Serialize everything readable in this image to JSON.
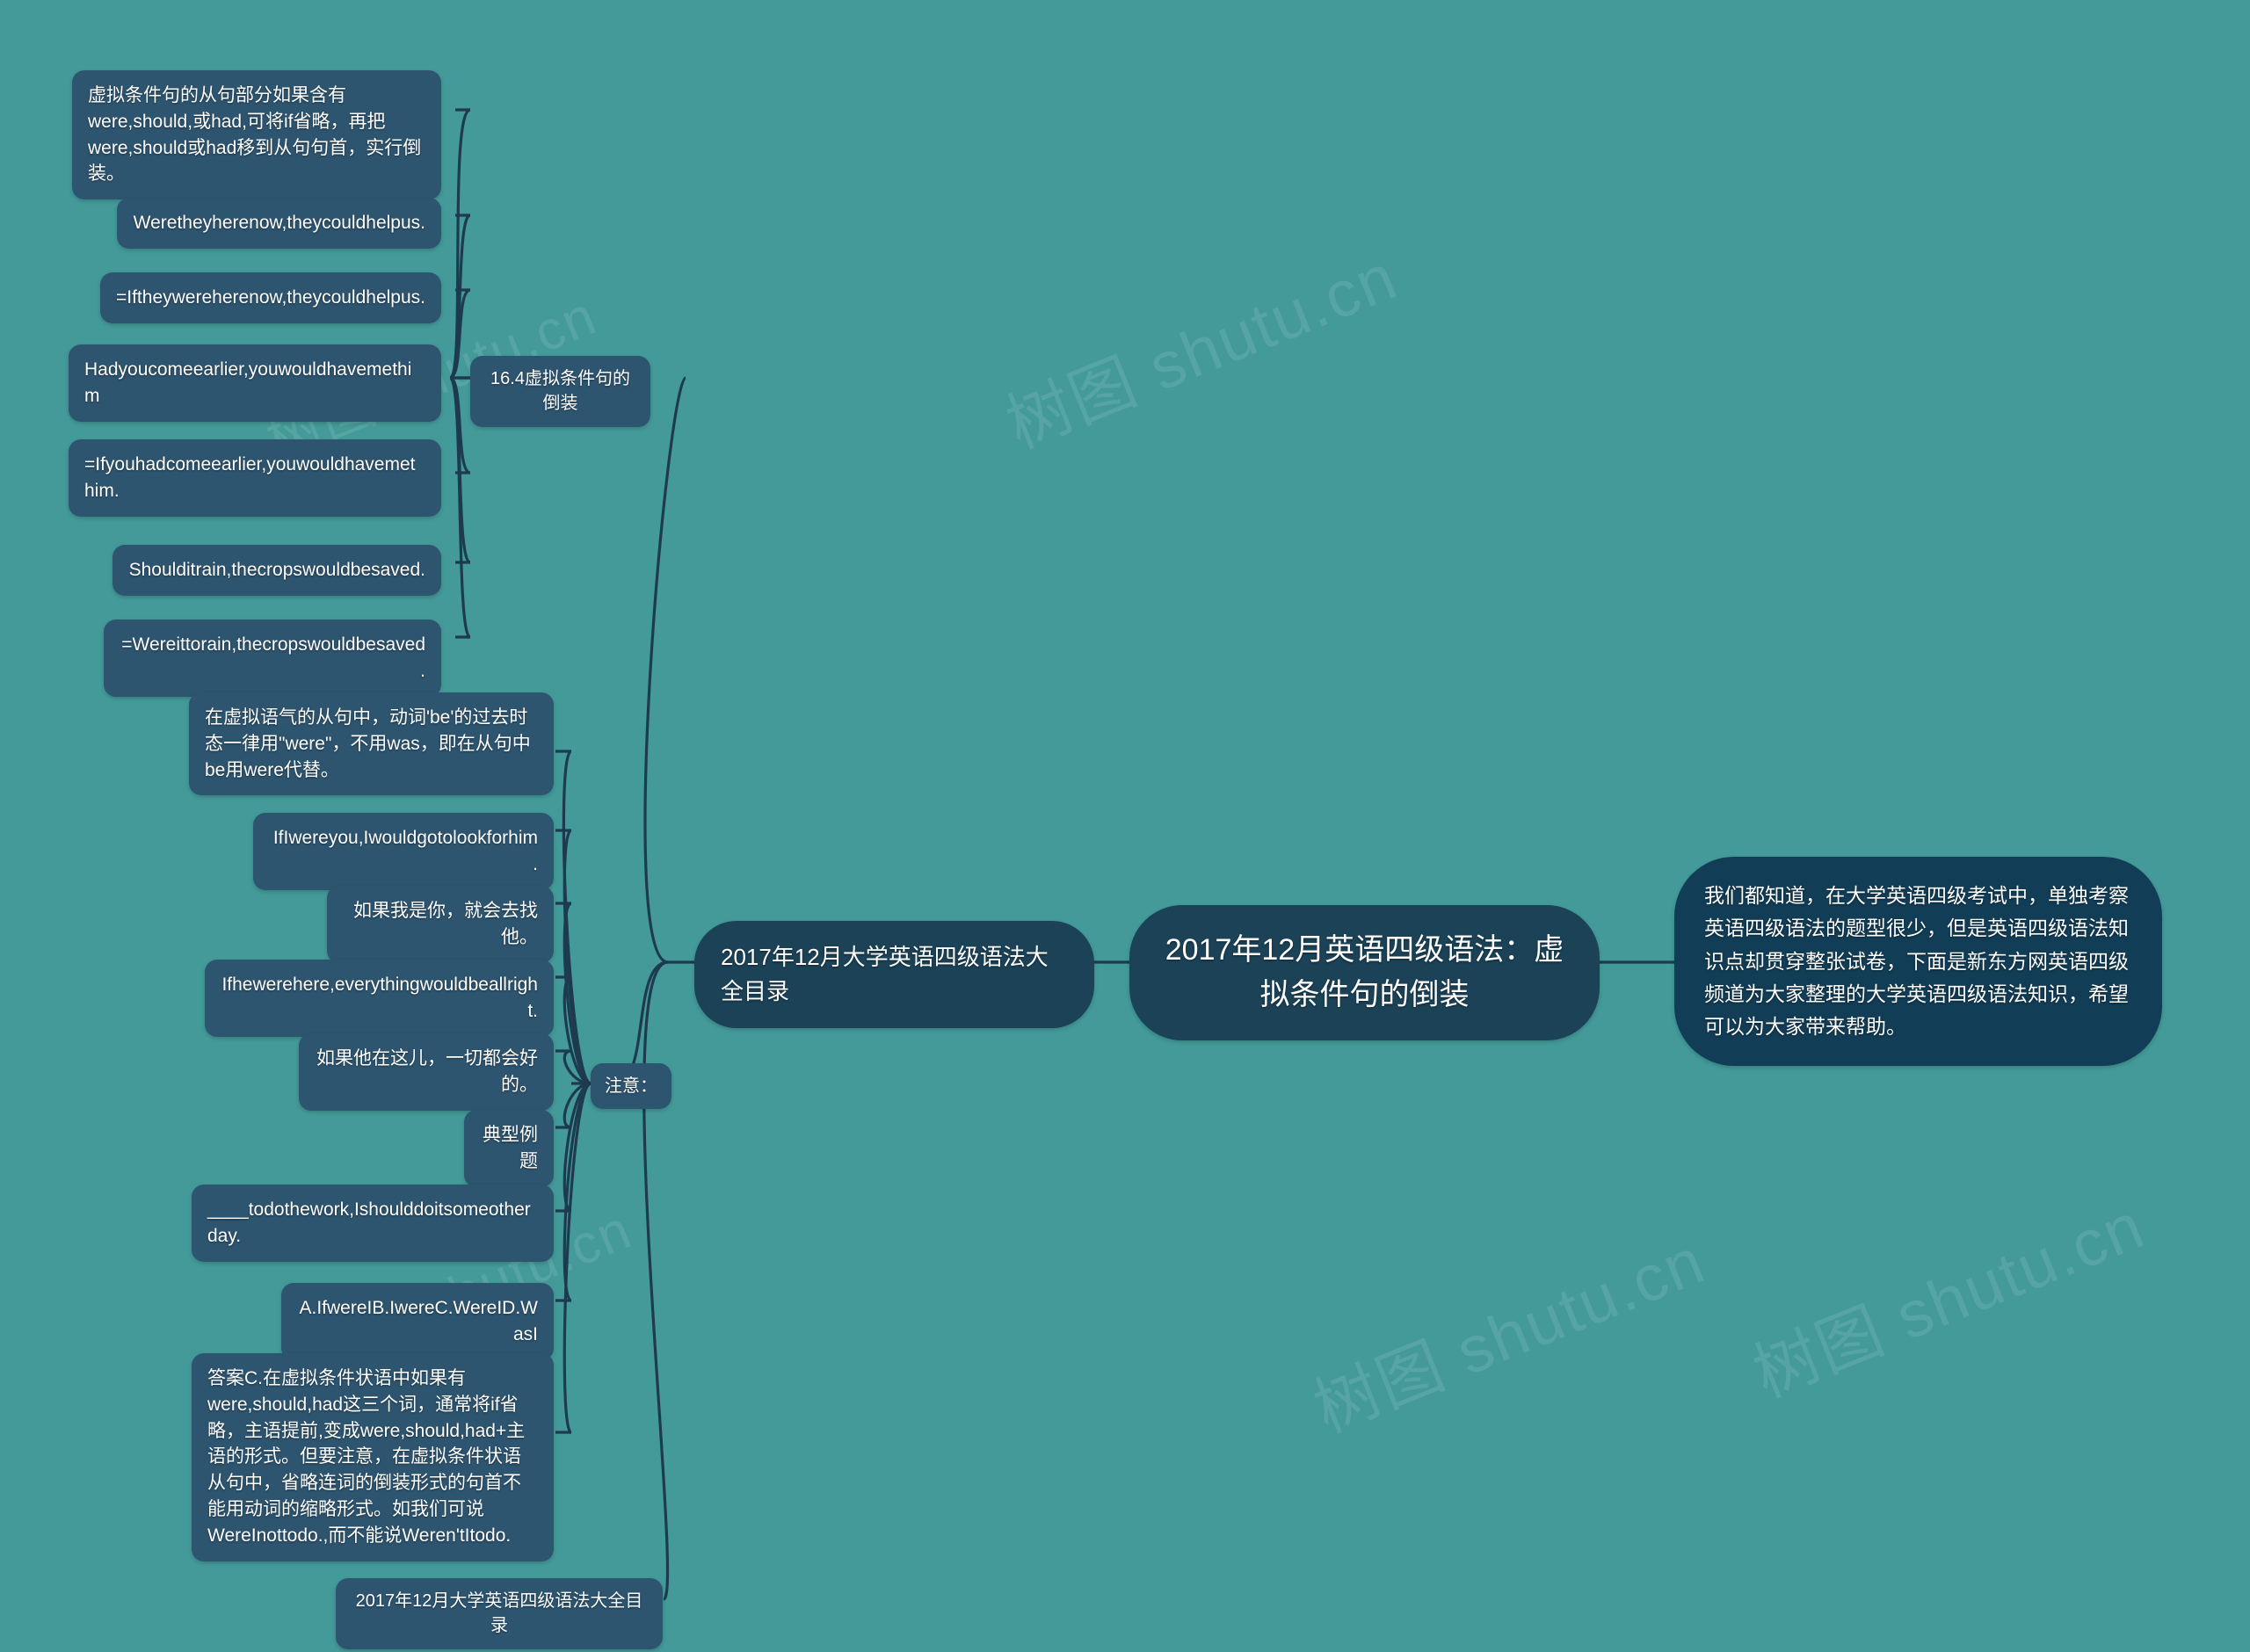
{
  "theme": {
    "background": "#439a99",
    "node_fill": "#2e5570",
    "trunk_fill": "#1b4257",
    "desc_fill": "#123d56",
    "edge_color": "#1d3a4f",
    "text_color": "#ffffff"
  },
  "watermarks": [
    "树图 shutu.cn",
    "树图 shutu.cn",
    "树图 shutu.cn",
    "树图 shutu.cn",
    "树图 shutu.cn"
  ],
  "mindmap": {
    "root": {
      "title": "2017年12月英语四级语法：虚拟条件句的倒装"
    },
    "description": "我们都知道，在大学英语四级考试中，单独考察英语四级语法的题型很少，但是英语四级语法知识点却贯穿整张试卷，下面是新东方网英语四级频道为大家整理的大学英语四级语法知识，希望可以为大家带来帮助。",
    "trunk": {
      "label": "2017年12月大学英语四级语法大全目录"
    },
    "branches": [
      {
        "label": "16.4虚拟条件句的倒装",
        "children": [
          {
            "text": "虚拟条件句的从句部分如果含有were,should,或had,可将if省略，再把were,should或had移到从句句首，实行倒装。"
          },
          {
            "text": "Weretheyherenow,theycouldhelpus."
          },
          {
            "text": "=Iftheywereherenow,theycouldhelpus."
          },
          {
            "text": "Hadyoucomeearlier,youwouldhavemethim"
          },
          {
            "text": "=Ifyouhadcomeearlier,youwouldhavemethim."
          },
          {
            "text": "Shoulditrain,thecropswouldbesaved."
          },
          {
            "text": "=Wereittorain,thecropswouldbesaved."
          }
        ]
      },
      {
        "label": "注意：",
        "children": [
          {
            "text": "在虚拟语气的从句中，动词'be'的过去时态一律用\"were\"，不用was，即在从句中be用were代替。"
          },
          {
            "text": "IfIwereyou,Iwouldgotolookforhim."
          },
          {
            "text": "如果我是你，就会去找他。"
          },
          {
            "text": "Ifhewerehere,everythingwouldbeallright."
          },
          {
            "text": "如果他在这儿，一切都会好的。"
          },
          {
            "text": "典型例题"
          },
          {
            "text": "____todothework,Ishoulddoitsomeotherday."
          },
          {
            "text": "A.IfwereIB.IwereC.WereID.WasI"
          },
          {
            "text": "答案C.在虚拟条件状语中如果有were,should,had这三个词，通常将if省略，主语提前,变成were,should,had+主语的形式。但要注意，在虚拟条件状语从句中，省略连词的倒装形式的句首不能用动词的缩略形式。如我们可说WereInottodo.,而不能说Weren'tItodo."
          }
        ]
      },
      {
        "label": "2017年12月大学英语四级语法大全目录",
        "children": []
      }
    ]
  }
}
